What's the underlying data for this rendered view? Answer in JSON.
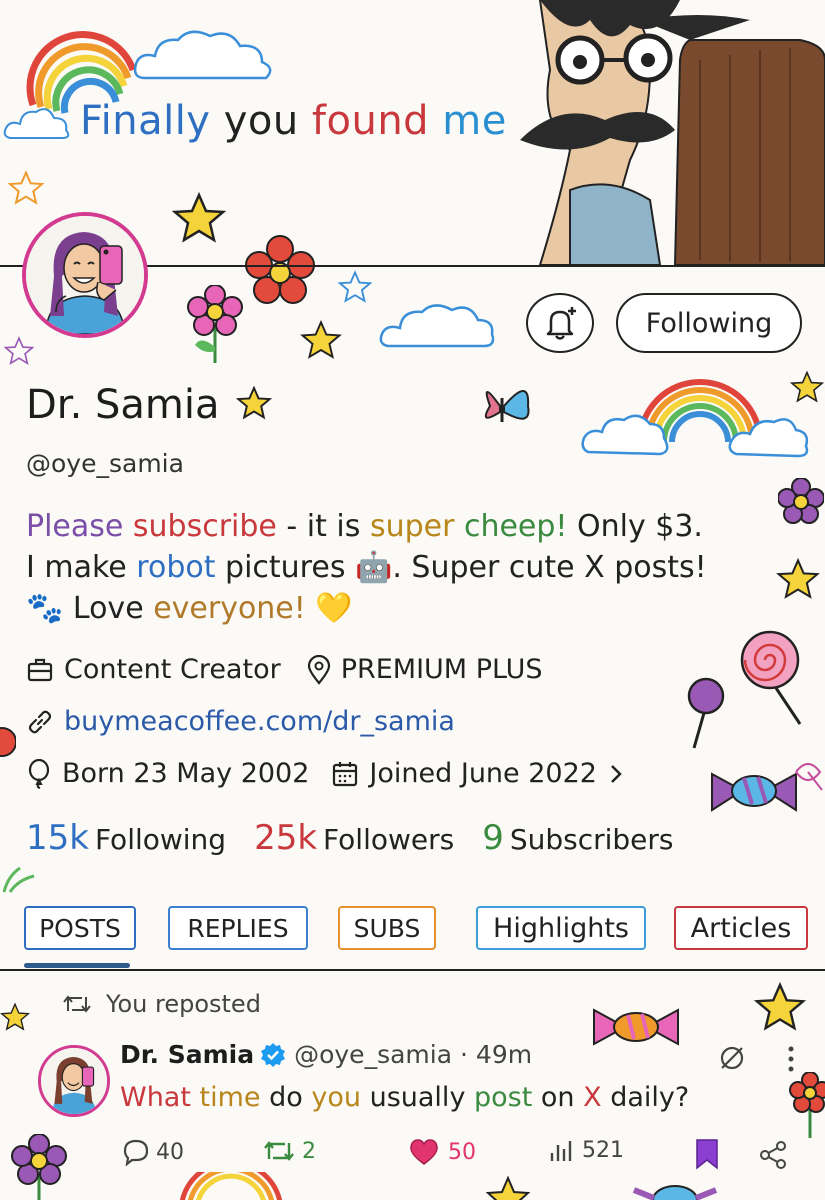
{
  "banner": {
    "tagline": [
      "Finally",
      "you",
      "found",
      "me"
    ]
  },
  "profile": {
    "name": "Dr. Samia",
    "handle": "@oye_samia",
    "follow_label": "Following",
    "bio": {
      "line1": [
        "Please",
        " ",
        "subscribe",
        " - it is ",
        "super",
        " ",
        "cheep!",
        " Only $3."
      ],
      "line2": [
        "I make ",
        "robot",
        " pictures ",
        "🤖",
        ". Super cute X posts!"
      ],
      "line3": [
        "🐾",
        " Love ",
        "everyone!",
        " ",
        "💛"
      ]
    },
    "category": "Content Creator",
    "location": "PREMIUM PLUS",
    "website": "buymeacoffee.com/dr_samia",
    "birth": "Born 23 May 2002",
    "joined": "Joined June 2022",
    "stats": {
      "following_count": "15k",
      "following_label": "Following",
      "followers_count": "25k",
      "followers_label": "Followers",
      "subscribers_count": "9",
      "subscribers_label": "Subscribers"
    }
  },
  "tabs": [
    "POSTS",
    "REPLIES",
    "SUBS",
    "Highlights",
    "Articles"
  ],
  "colors": {
    "posts": "#2f6fc2",
    "replies": "#3a7fd0",
    "subs": "#e8902a",
    "highlights": "#3a9ed8",
    "articles": "#c8383c",
    "verified": "#1d9bf0",
    "heart": "#e2346f",
    "bookmark": "#8a3fd1"
  },
  "post": {
    "repost_label": "You reposted",
    "author": "Dr. Samia",
    "handle": "@oye_samia",
    "time": "· 49m",
    "text": [
      "What",
      " ",
      "time",
      " do ",
      "you",
      " usually ",
      "post",
      " on ",
      "X",
      " daily?"
    ],
    "replies": "40",
    "reposts": "2",
    "likes": "50",
    "views": "521"
  }
}
